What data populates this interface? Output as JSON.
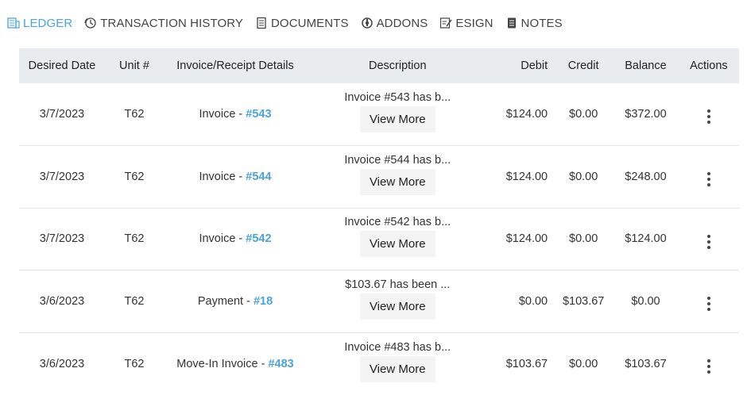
{
  "tabs": [
    {
      "label": "LEDGER",
      "icon": "ledger-icon",
      "active": true
    },
    {
      "label": "TRANSACTION HISTORY",
      "icon": "history-icon",
      "active": false
    },
    {
      "label": "DOCUMENTS",
      "icon": "document-icon",
      "active": false
    },
    {
      "label": "ADDONS",
      "icon": "addon-icon",
      "active": false
    },
    {
      "label": "ESIGN",
      "icon": "signature-icon",
      "active": false
    },
    {
      "label": "NOTES",
      "icon": "notes-icon",
      "active": false
    }
  ],
  "table": {
    "headers": [
      "Desired Date",
      "Unit #",
      "Invoice/Receipt Details",
      "Description",
      "Debit",
      "Credit",
      "Balance",
      "Actions"
    ],
    "view_more_label": "View More",
    "rows": [
      {
        "date": "3/7/2023",
        "unit": "T62",
        "detail_prefix": "Invoice - ",
        "detail_link": "#543",
        "description": "Invoice #543 has b...",
        "debit": "$124.00",
        "credit": "$0.00",
        "balance": "$372.00"
      },
      {
        "date": "3/7/2023",
        "unit": "T62",
        "detail_prefix": "Invoice - ",
        "detail_link": "#544",
        "description": "Invoice #544 has b...",
        "debit": "$124.00",
        "credit": "$0.00",
        "balance": "$248.00"
      },
      {
        "date": "3/7/2023",
        "unit": "T62",
        "detail_prefix": "Invoice - ",
        "detail_link": "#542",
        "description": "Invoice #542 has b...",
        "debit": "$124.00",
        "credit": "$0.00",
        "balance": "$124.00"
      },
      {
        "date": "3/6/2023",
        "unit": "T62",
        "detail_prefix": "Payment - ",
        "detail_link": "#18",
        "description": "$103.67 has been ...",
        "debit": "$0.00",
        "credit": "$103.67",
        "balance": "$0.00"
      },
      {
        "date": "3/6/2023",
        "unit": "T62",
        "detail_prefix": "Move-In Invoice - ",
        "detail_link": "#483",
        "description": "Invoice #483 has b...",
        "debit": "$103.67",
        "credit": "$0.00",
        "balance": "$103.67"
      }
    ]
  },
  "colors": {
    "accent": "#4aa3df",
    "header_bg": "#e9ecef",
    "button_bg": "#f4f4f4"
  }
}
